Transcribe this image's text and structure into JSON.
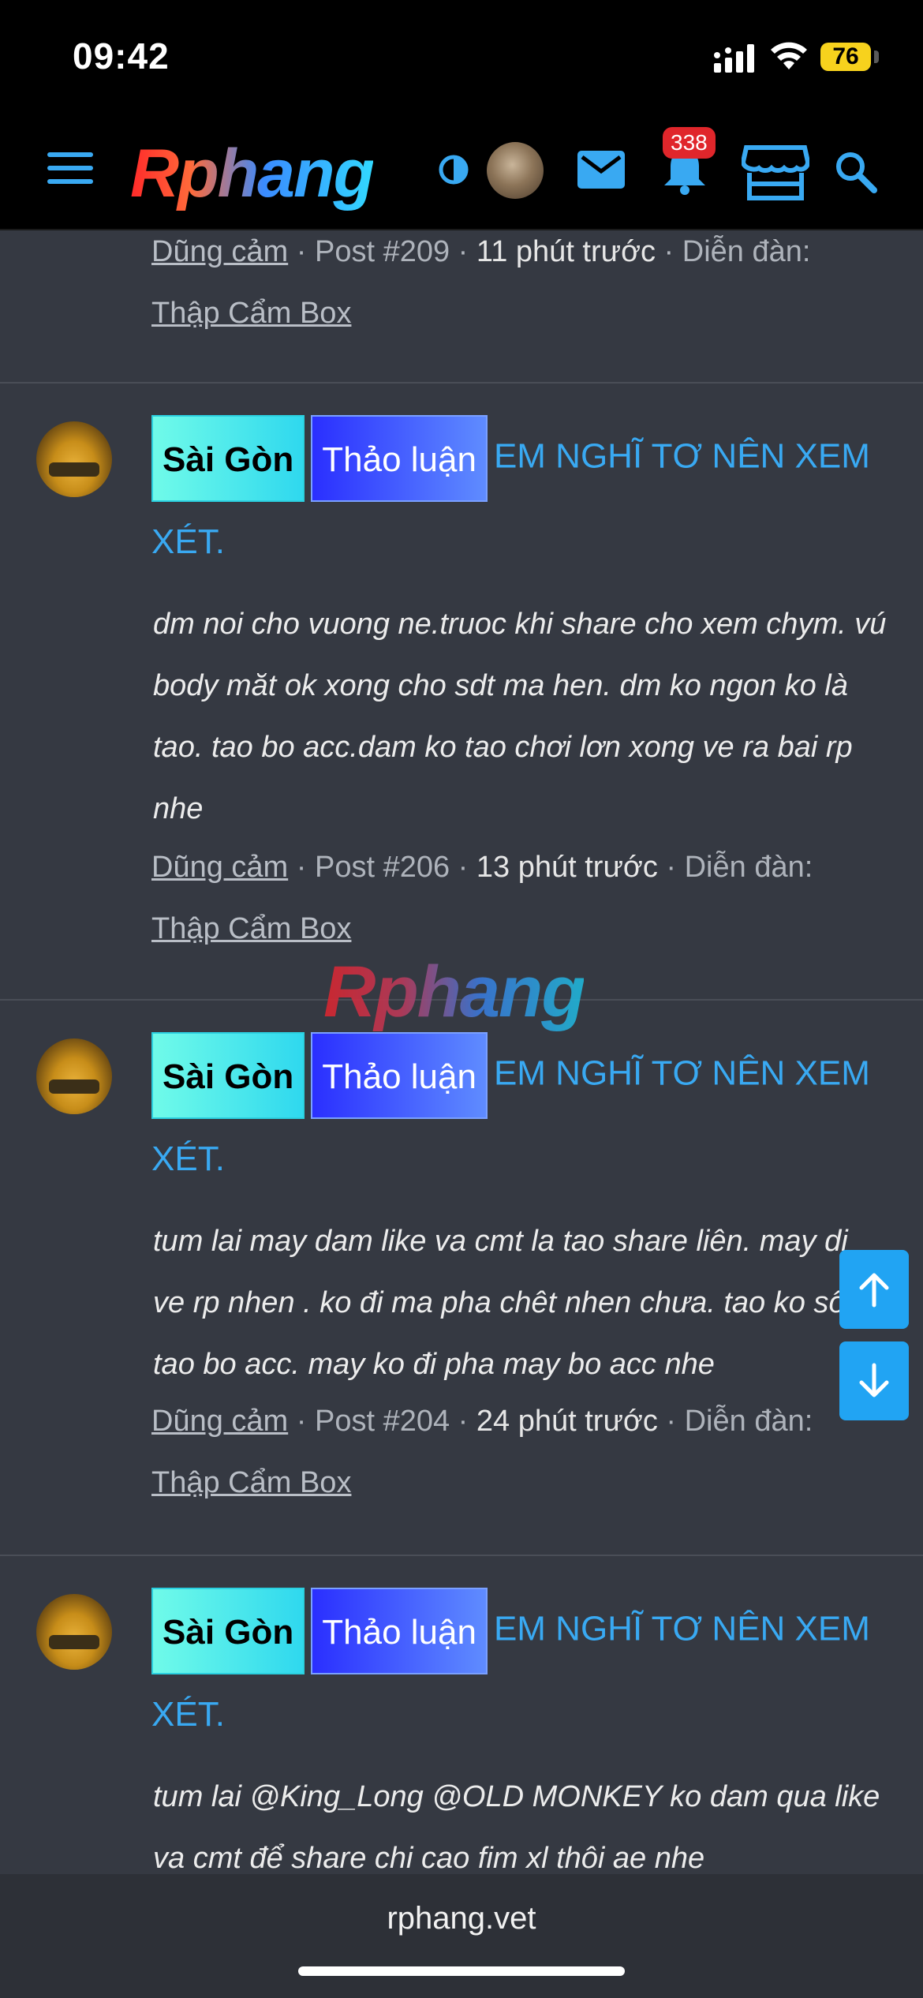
{
  "status_bar": {
    "time": "09:42",
    "battery": "76"
  },
  "header": {
    "logo": "Rphang",
    "notification_count": "338"
  },
  "top_meta": {
    "author": "Dũng cảm",
    "post": "Post #209",
    "time": "11 phút trước",
    "forum_label": "Diễn đàn:",
    "forum": "Thập Cẩm Box"
  },
  "posts": [
    {
      "tag1": "Sài Gòn",
      "tag2": "Thảo luận",
      "title": "EM NGHĨ TƠ NÊN XEM XÉT.",
      "body": "dm noi cho vuong ne.truoc khi share cho xem chym. vú body măt ok xong cho sdt ma hen. dm ko ngon ko là tao. tao bo acc.dam ko tao chơi lơn xong ve ra bai rp nhe",
      "author": "Dũng cảm",
      "post": "Post #206",
      "time": "13 phút trước",
      "forum_label": "Diễn đàn:",
      "forum": "Thập Cẩm Box"
    },
    {
      "tag1": "Sài Gòn",
      "tag2": "Thảo luận",
      "title": "EM NGHĨ TƠ NÊN XEM XÉT.",
      "body": "tum lai may dam like va cmt la tao share liên. may di ve rp nhen . ko đi ma pha chêt nhen chưa. tao ko sô tao bo acc. may ko đi pha may bo acc nhe",
      "author": "Dũng cảm",
      "post": "Post #204",
      "time": "24 phút trước",
      "forum_label": "Diễn đàn:",
      "forum": "Thập Cẩm Box"
    },
    {
      "tag1": "Sài Gòn",
      "tag2": "Thảo luận",
      "title": "EM NGHĨ TƠ NÊN XEM XÉT.",
      "body": "tum lai @King_Long @OLD MONKEY ko dam qua like va cmt để share chi cao fim xl thôi ae nhe"
    }
  ],
  "watermark": "Rphang",
  "browser": {
    "url": "rphang.vet"
  },
  "colors": {
    "accent": "#39a9f2",
    "badge": "#e0262b",
    "background": "#353942"
  }
}
